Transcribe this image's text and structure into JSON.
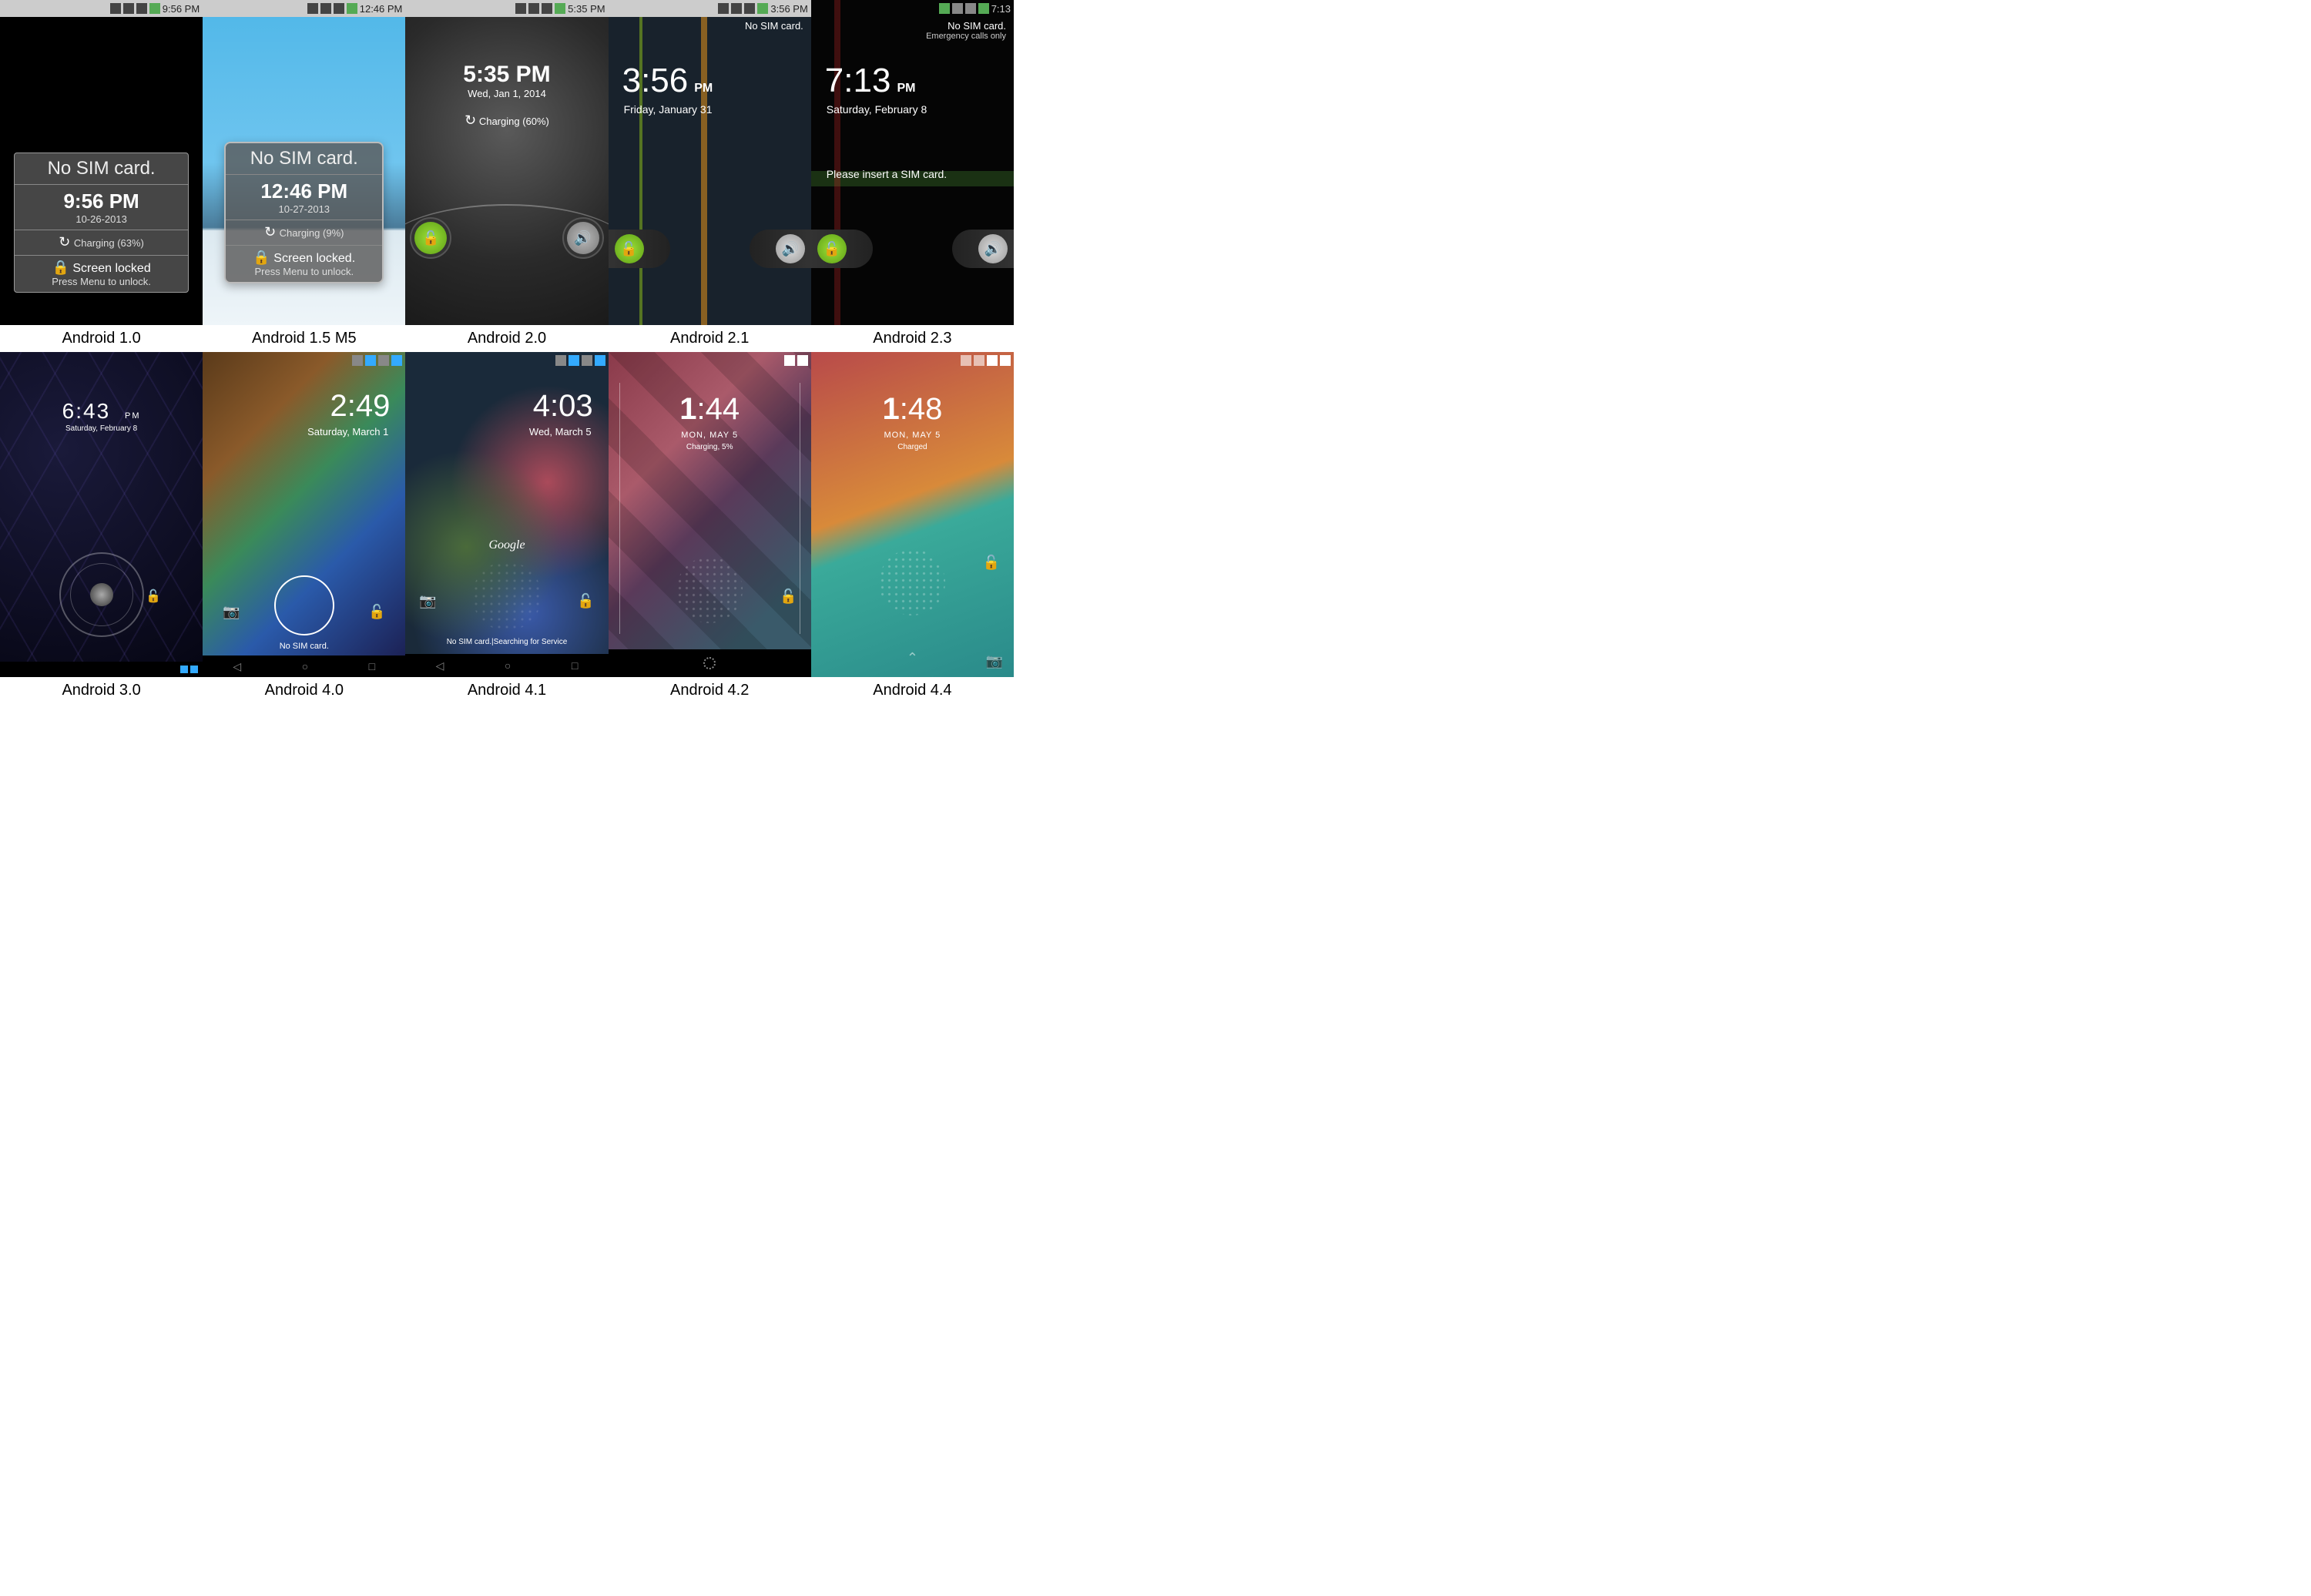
{
  "screens": [
    {
      "caption": "Android 1.0",
      "status_time": "9:56 PM",
      "no_sim": "No SIM card.",
      "time": "9:56 PM",
      "date": "10-26-2013",
      "charging": "Charging (63%)",
      "locked": "Screen locked",
      "hint": "Press Menu to unlock."
    },
    {
      "caption": "Android 1.5 M5",
      "status_time": "12:46 PM",
      "no_sim": "No SIM card.",
      "time": "12:46 PM",
      "date": "10-27-2013",
      "charging": "Charging (9%)",
      "locked": "Screen locked.",
      "hint": "Press Menu to unlock."
    },
    {
      "caption": "Android 2.0",
      "status_time": "5:35 PM",
      "time": "5:35 PM",
      "date": "Wed, Jan 1, 2014",
      "charging": "Charging (60%)"
    },
    {
      "caption": "Android 2.1",
      "status_time": "3:56 PM",
      "no_sim": "No SIM card.",
      "time": "3:56",
      "pm": "PM",
      "date": "Friday, January 31"
    },
    {
      "caption": "Android 2.3",
      "status_time": "7:13",
      "no_sim": "No SIM card.",
      "emergency": "Emergency calls only",
      "time": "7:13",
      "pm": "PM",
      "date": "Saturday, February 8",
      "sim_msg": "Please insert a SIM card."
    },
    {
      "caption": "Android 3.0",
      "time": "6:43",
      "pm": "PM",
      "date": "Saturday, February 8"
    },
    {
      "caption": "Android 4.0",
      "time": "2:49",
      "date": "Saturday, March 1",
      "sim": "No SIM card."
    },
    {
      "caption": "Android 4.1",
      "time": "4:03",
      "date": "Wed, March 5",
      "google": "Google",
      "status": "No SIM card.|Searching for Service"
    },
    {
      "caption": "Android 4.2",
      "time_h": "1",
      "time_m": ":44",
      "date": "MON, MAY 5",
      "charging": "Charging, 5%"
    },
    {
      "caption": "Android 4.4",
      "time_h": "1",
      "time_m": ":48",
      "date": "MON, MAY 5",
      "charging": "Charged"
    }
  ],
  "icons": {
    "lock": "🔒",
    "unlock": "🔓",
    "sound": "🔊",
    "charge": "↻",
    "camera": "📷",
    "up": "⌃"
  }
}
